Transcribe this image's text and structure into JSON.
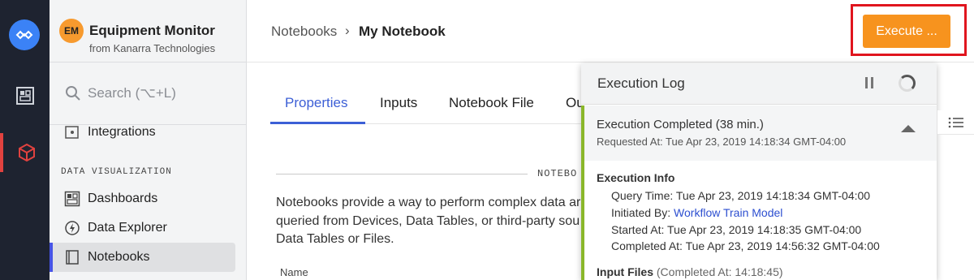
{
  "org": {
    "initials": "EM",
    "name": "Equipment Monitor",
    "subtitle": "from Kanarra Technologies"
  },
  "search": {
    "placeholder": "Search (⌥+L)"
  },
  "sidebar": {
    "partial_item": "Integrations",
    "section_title": "DATA VISUALIZATION",
    "items": [
      {
        "label": "Dashboards",
        "icon": "dashboard-icon"
      },
      {
        "label": "Data Explorer",
        "icon": "data-explorer-icon"
      },
      {
        "label": "Notebooks",
        "icon": "notebook-icon",
        "selected": true
      }
    ]
  },
  "breadcrumb": {
    "parent": "Notebooks",
    "separator": "›",
    "current": "My Notebook"
  },
  "execute_button": {
    "label": "Execute ...",
    "color": "#f7931e"
  },
  "tabs": [
    {
      "label": "Properties",
      "active": true
    },
    {
      "label": "Inputs"
    },
    {
      "label": "Notebook File"
    },
    {
      "label": "Ou"
    }
  ],
  "section_divider": "NOTEBO",
  "description_lines": [
    "Notebooks provide a way to perform complex data ar",
    "queried from Devices, Data Tables, or third-party sou",
    "Data Tables or Files."
  ],
  "name_label": "Name",
  "execution_log": {
    "title": "Execution Log",
    "summary_title": "Execution Completed (38 min.)",
    "summary_sub": "Requested At: Tue Apr 23, 2019 14:18:34 GMT-04:00",
    "info_title": "Execution Info",
    "query_time": "Query Time: Tue Apr 23, 2019 14:18:34 GMT-04:00",
    "initiated_by_label": "Initiated By: ",
    "initiated_by_link": "Workflow Train Model",
    "started_at": "Started At: Tue Apr 23, 2019 14:18:35 GMT-04:00",
    "completed_at": "Completed At: Tue Apr 23, 2019 14:56:32 GMT-04:00",
    "input_files_label": "Input Files",
    "input_files_completed": "(Completed At: 14:18:45)",
    "status_color": "#8ab72a"
  },
  "colors": {
    "accent": "#3c5fd6",
    "rail": "#1e2330",
    "highlight": "#e0151e"
  }
}
